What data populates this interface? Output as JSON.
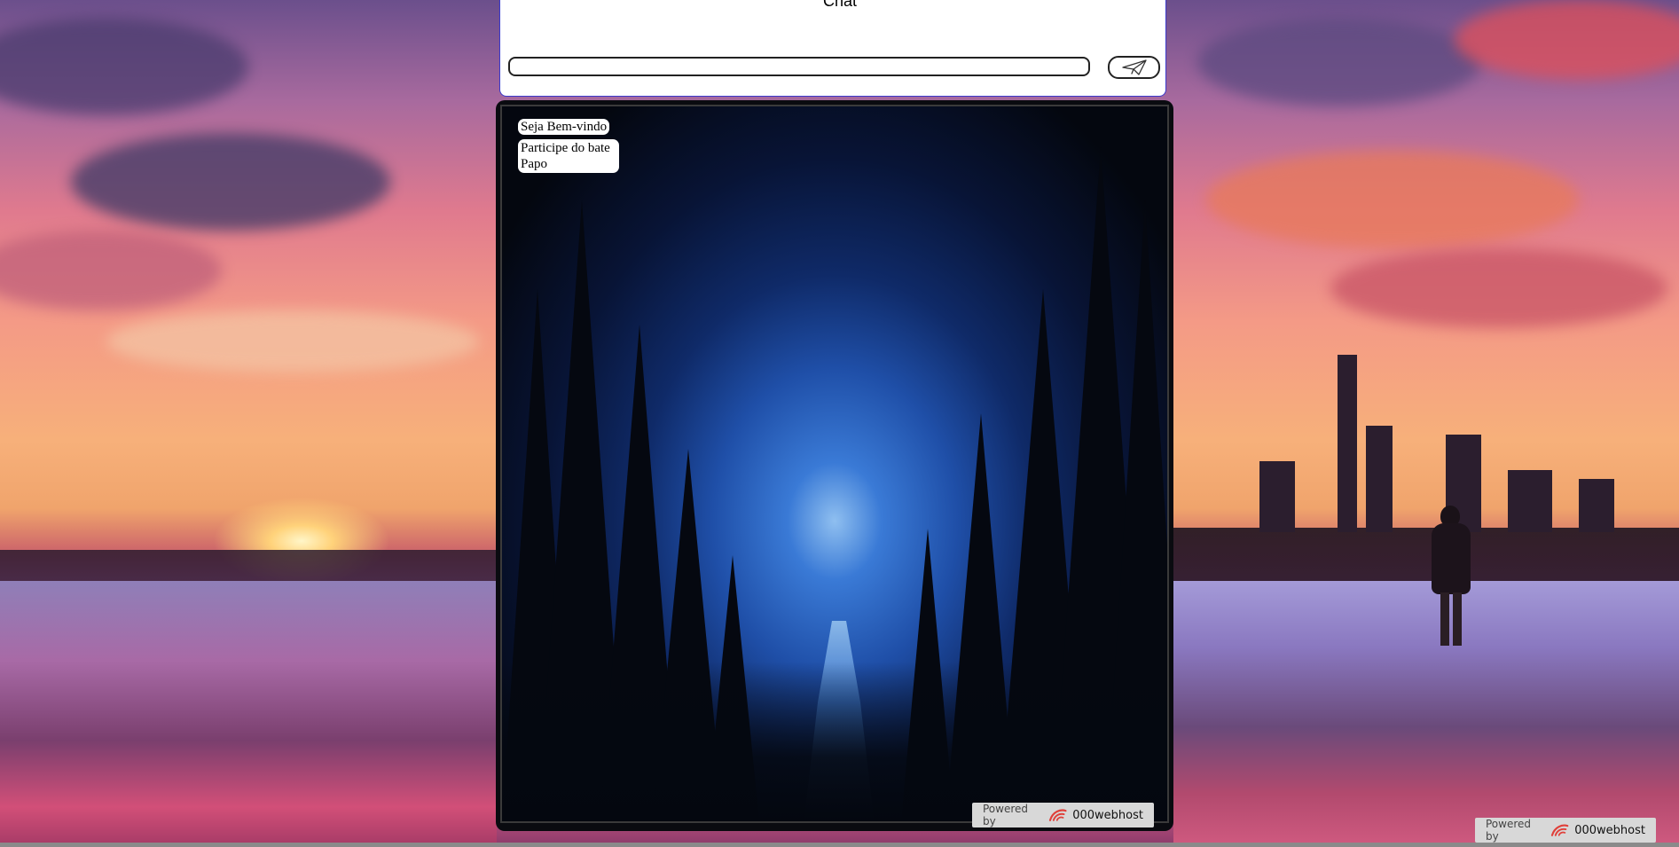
{
  "chat": {
    "legend": "Chat",
    "input_value": "",
    "input_placeholder": "",
    "send_icon": "paper-plane-icon"
  },
  "messages": [
    {
      "text": "Seja Bem-vindo"
    },
    {
      "text": "Participe do bate Papo"
    }
  ],
  "footer_badge": {
    "powered_label": "Powered by",
    "brand": "000webhost",
    "logo_icon": "000webhost-logo-icon",
    "logo_color": "#e0403a"
  }
}
